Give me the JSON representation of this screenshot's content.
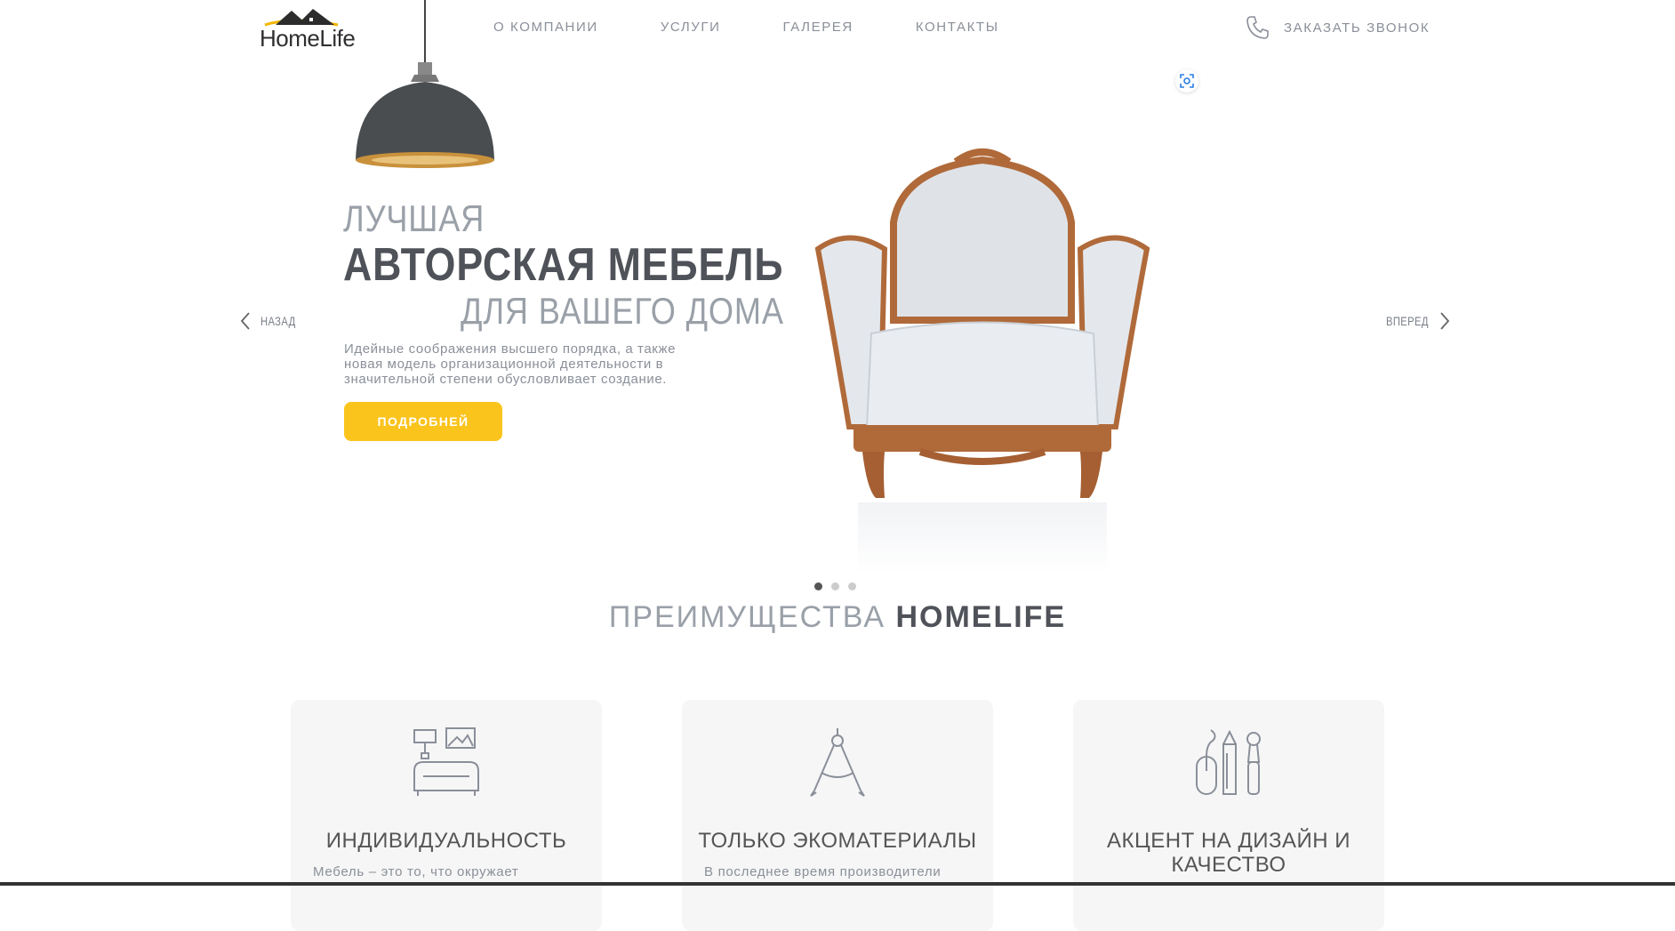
{
  "header": {
    "logo_text": "HomeLife",
    "nav": [
      "О КОМПАНИИ",
      "УСЛУГИ",
      "ГАЛЕРЕЯ",
      "КОНТАКТЫ"
    ],
    "callback_label": "ЗАКАЗАТЬ ЗВОНОК"
  },
  "hero": {
    "line1": "ЛУЧШАЯ",
    "line2": "АВТОРСКАЯ МЕБЕЛЬ",
    "line3": "ДЛЯ ВАШЕГО ДОМА",
    "description": "Идейные соображения высшего порядка, а также новая модель организационной деятельности в значительной степени обусловливает создание.",
    "button_label": "ПОДРОБНЕЙ",
    "prev_label": "НАЗАД",
    "next_label": "ВПЕРЕД",
    "slides_total": 3,
    "active_slide": 1
  },
  "advantages": {
    "title_light": "ПРЕИМУЩЕСТВА",
    "title_bold": "HOMELIFE",
    "cards": [
      {
        "icon": "sofa-design-icon",
        "title": "ИНДИВИДУАЛЬНОСТЬ",
        "text": "Мебель – это то, что окружает"
      },
      {
        "icon": "compass-icon",
        "title": "ТОЛЬКО ЭКОМАТЕРИАЛЫ",
        "text": "В последнее время производители"
      },
      {
        "icon": "design-tools-icon",
        "title": "АКЦЕНТ НА ДИЗАЙН И КАЧЕСТВО",
        "text": ""
      }
    ]
  },
  "colors": {
    "accent": "#fbc41d",
    "dark_text": "#4f5258",
    "light_text": "#9aa0a8"
  }
}
